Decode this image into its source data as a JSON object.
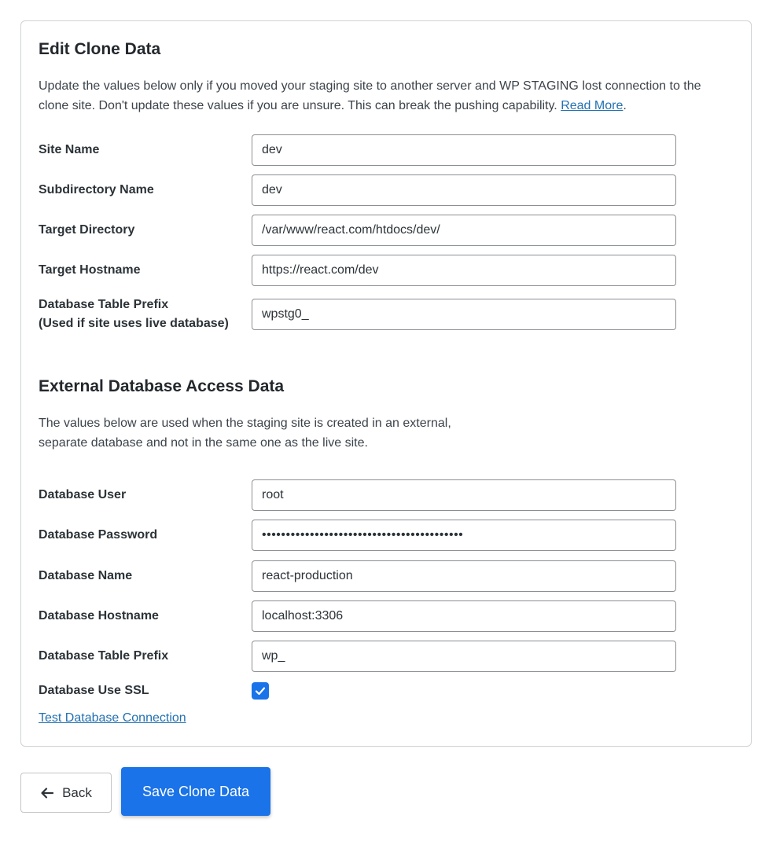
{
  "edit_section": {
    "title": "Edit Clone Data",
    "intro": "Update the values below only if you moved your staging site to another server and WP STAGING lost connection to the clone site. Don't update these values if you are unsure. This can break the pushing capability.",
    "read_more": "Read More",
    "fields": [
      {
        "label": "Site Name",
        "value": "dev"
      },
      {
        "label": "Subdirectory Name",
        "value": "dev"
      },
      {
        "label": "Target Directory",
        "value": "/var/www/react.com/htdocs/dev/"
      },
      {
        "label": "Target Hostname",
        "value": "https://react.com/dev"
      },
      {
        "label": "Database Table Prefix",
        "label_sub": "(Used if site uses live database)",
        "value": "wpstg0_"
      }
    ]
  },
  "external_section": {
    "title": "External Database Access Data",
    "intro_line1": "The values below are used when the staging site is created in an external,",
    "intro_line2": "separate database and not in the same one as the live site.",
    "fields": [
      {
        "label": "Database User",
        "value": "root"
      },
      {
        "label": "Database Password",
        "value": "••••••••••••••••••••••••••••••••••••••••••"
      },
      {
        "label": "Database Name",
        "value": "react-production"
      },
      {
        "label": "Database Hostname",
        "value": "localhost:3306"
      },
      {
        "label": "Database Table Prefix",
        "value": "wp_"
      }
    ],
    "ssl_label": "Database Use SSL",
    "ssl_checked": true,
    "test_link": "Test Database Connection"
  },
  "actions": {
    "back_label": "Back",
    "save_label": "Save Clone Data"
  },
  "colors": {
    "accent": "#1a73e8",
    "link": "#2271b1"
  }
}
